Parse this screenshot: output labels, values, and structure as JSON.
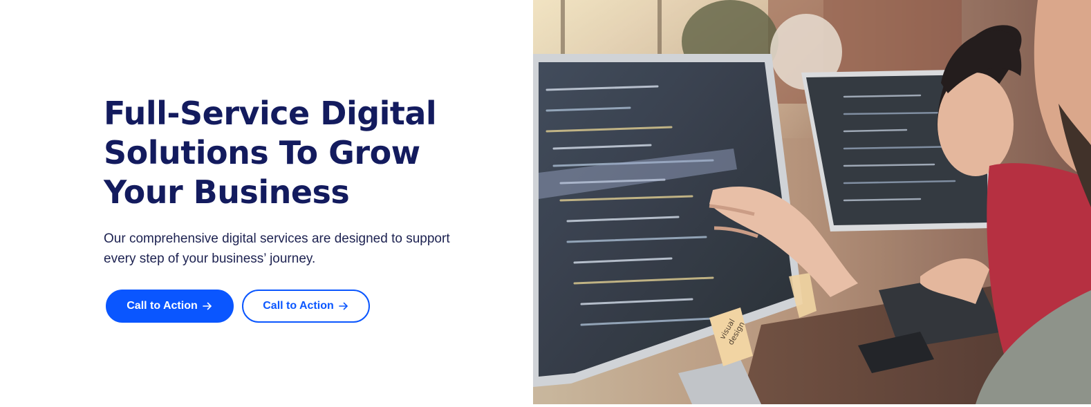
{
  "hero": {
    "title_lines": [
      "Full-Service Digital",
      "Solutions To Grow",
      "Your Business"
    ],
    "description_lines": [
      "Our comprehensive digital services are designed to support",
      "every step of your business’ journey."
    ],
    "primary_button": {
      "label": "Call to Action",
      "icon": "arrow-right-icon"
    },
    "secondary_button": {
      "label": "Call to Action",
      "icon": "arrow-right-icon"
    }
  },
  "image": {
    "sticky_note_text": [
      "visual",
      "design"
    ]
  },
  "colors": {
    "heading": "#131b5e",
    "body_text": "#1c2150",
    "accent": "#0a56ff",
    "background": "#ffffff"
  }
}
